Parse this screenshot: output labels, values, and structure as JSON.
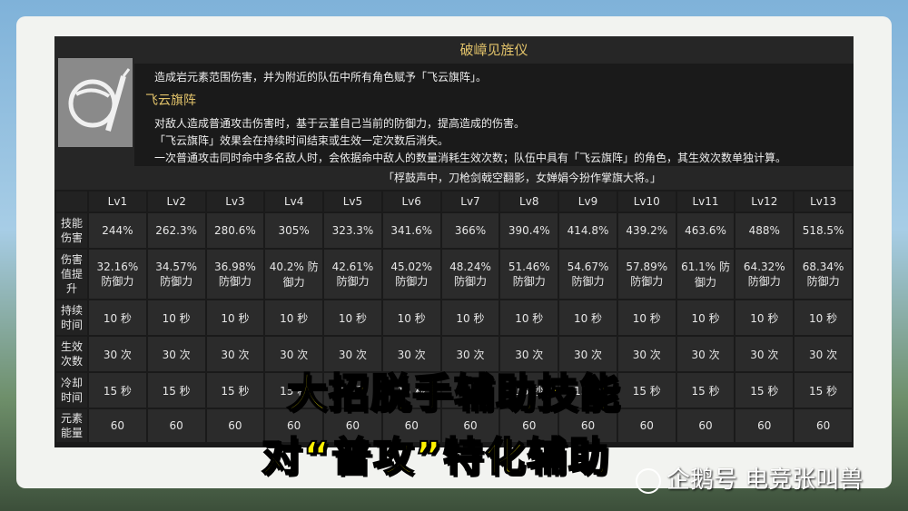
{
  "skill": {
    "title": "破嶂见旌仪",
    "line1": "造成岩元素范围伤害，并为附近的队伍中所有角色赋予「飞云旗阵」。",
    "subtitle": "飞云旗阵",
    "line2": "对敌人造成普通攻击伤害时，基于云堇自己当前的防御力，提高造成的伤害。",
    "line3": "「飞云旗阵」效果会在持续时间结束或生效一定次数后消失。",
    "line4": "一次普通攻击同时命中多名敌人时，会依据命中敌人的数量消耗生效次数；队伍中具有「飞云旗阵」的角色，其生效次数单独计算。",
    "quote": "「桴鼓声中，刀枪剑戟空翻影，女婵娟今扮作掌旗大将。」"
  },
  "table": {
    "levels": [
      "Lv1",
      "Lv2",
      "Lv3",
      "Lv4",
      "Lv5",
      "Lv6",
      "Lv7",
      "Lv8",
      "Lv9",
      "Lv10",
      "Lv11",
      "Lv12",
      "Lv13"
    ],
    "rows": [
      {
        "label": "技能伤害",
        "values": [
          "244%",
          "262.3%",
          "280.6%",
          "305%",
          "323.3%",
          "341.6%",
          "366%",
          "390.4%",
          "414.8%",
          "439.2%",
          "463.6%",
          "488%",
          "518.5%"
        ]
      },
      {
        "label": "伤害值提升",
        "values": [
          "32.16% 防御力",
          "34.57% 防御力",
          "36.98% 防御力",
          "40.2% 防御力",
          "42.61% 防御力",
          "45.02% 防御力",
          "48.24% 防御力",
          "51.46% 防御力",
          "54.67% 防御力",
          "57.89% 防御力",
          "61.1% 防御力",
          "64.32% 防御力",
          "68.34% 防御力"
        ]
      },
      {
        "label": "持续时间",
        "values": [
          "10 秒",
          "10 秒",
          "10 秒",
          "10 秒",
          "10 秒",
          "10 秒",
          "10 秒",
          "10 秒",
          "10 秒",
          "10 秒",
          "10 秒",
          "10 秒",
          "10 秒"
        ]
      },
      {
        "label": "生效次数",
        "values": [
          "30 次",
          "30 次",
          "30 次",
          "30 次",
          "30 次",
          "30 次",
          "30 次",
          "30 次",
          "30 次",
          "30 次",
          "30 次",
          "30 次",
          "30 次"
        ]
      },
      {
        "label": "冷却时间",
        "values": [
          "15 秒",
          "15 秒",
          "15 秒",
          "15 秒",
          "15 秒",
          "15 秒",
          "15 秒",
          "15 秒",
          "15 秒",
          "15 秒",
          "15 秒",
          "15 秒",
          "15 秒"
        ]
      },
      {
        "label": "元素能量",
        "values": [
          "60",
          "60",
          "60",
          "60",
          "60",
          "60",
          "60",
          "60",
          "60",
          "60",
          "60",
          "60",
          "60"
        ]
      }
    ]
  },
  "overlay": {
    "line1": "大招脱手辅助技能",
    "line2": "对“普攻”特化辅助"
  },
  "watermark": "企鹅号 电竞张叫兽"
}
